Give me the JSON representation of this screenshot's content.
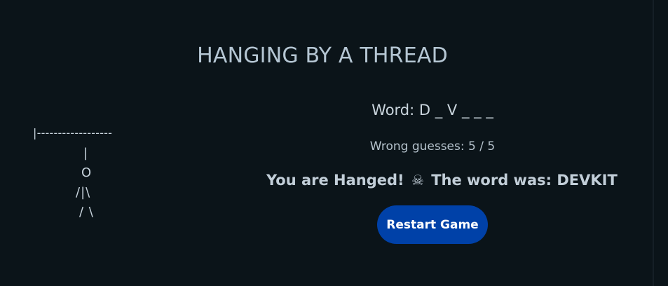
{
  "title": "HANGING BY A THREAD",
  "gallows": {
    "top": "|------------------",
    "rope": "|",
    "head": "O",
    "body": "/|\\",
    "legs": "/ \\"
  },
  "word": {
    "label": "Word:",
    "display": "D _ V _ _ _"
  },
  "wrong_guesses": {
    "label": "Wrong guesses:",
    "count": "5",
    "separator": "/",
    "max": "5"
  },
  "result": {
    "prefix": "You are Hanged!",
    "icon": "skull-crossbones-icon",
    "icon_glyph": "☠",
    "suffix": "The word was: DEVKIT"
  },
  "restart_label": "Restart Game",
  "colors": {
    "background": "#0b1419",
    "button": "#0041a8",
    "text": "#c9d4dc"
  }
}
